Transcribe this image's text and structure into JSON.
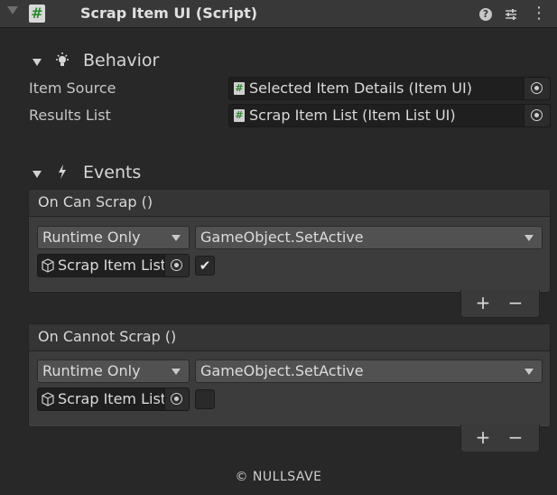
{
  "header": {
    "title": "Scrap Item UI (Script)",
    "script_icon": "#",
    "help_icon": "?",
    "presets_icon": "presets-icon",
    "menu_icon": "⋮"
  },
  "behavior": {
    "title": "Behavior",
    "icon": "lightbulb-icon",
    "fields": [
      {
        "label": "Item Source",
        "value": "Selected Item Details (Item UI)",
        "icon": "#"
      },
      {
        "label": "Results List",
        "value": "Scrap Item List (Item List UI)",
        "icon": "#"
      }
    ]
  },
  "events": {
    "title": "Events",
    "icon": "lightning-icon",
    "items": [
      {
        "header": "On Can Scrap ()",
        "runtime": "Runtime Only",
        "function": "GameObject.SetActive",
        "target": "Scrap Item List",
        "checked": true,
        "check_glyph": "✔",
        "add": "+",
        "remove": "−"
      },
      {
        "header": "On Cannot Scrap ()",
        "runtime": "Runtime Only",
        "function": "GameObject.SetActive",
        "target": "Scrap Item List",
        "checked": false,
        "check_glyph": "",
        "add": "+",
        "remove": "−"
      }
    ]
  },
  "footer": {
    "text": "© NULLSAVE"
  },
  "colors": {
    "background": "#282828",
    "header": "#383838",
    "script_icon_green": "#2a8a2a"
  }
}
